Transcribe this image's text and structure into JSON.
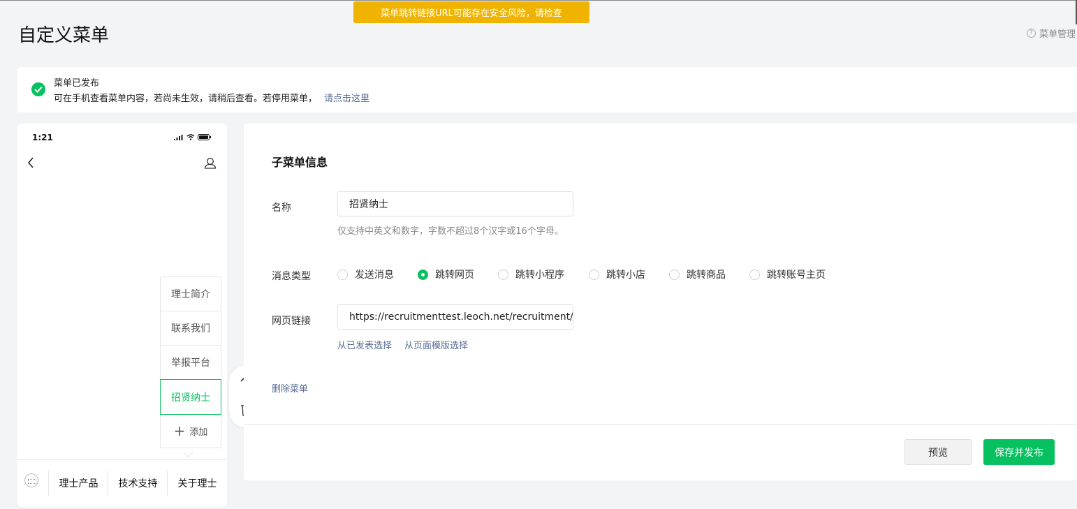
{
  "warning_toast": "菜单跳转链接URL可能存在安全风险，请检查",
  "page_title": "自定义菜单",
  "help_link": "菜单管理",
  "notice": {
    "title": "菜单已发布",
    "desc": "可在手机查看菜单内容，若尚未生效，请稍后查看。若停用菜单，",
    "link": "请点击这里"
  },
  "phone": {
    "time": "1:21",
    "submenu": [
      "理士简介",
      "联系我们",
      "举报平台",
      "招贤纳士"
    ],
    "selected_submenu": "招贤纳士",
    "add_label": "添加",
    "menu_bar": [
      "理士产品",
      "技术支持",
      "关于理士"
    ]
  },
  "editor": {
    "title": "子菜单信息",
    "name_label": "名称",
    "name_value": "招贤纳士",
    "name_hint": "仅支持中英文和数字，字数不超过8个汉字或16个字母。",
    "type_label": "消息类型",
    "types": [
      "发送消息",
      "跳转网页",
      "跳转小程序",
      "跳转小店",
      "跳转商品",
      "跳转账号主页"
    ],
    "selected_type": "跳转网页",
    "url_label": "网页链接",
    "url_value": "https://recruitmenttest.leoch.net/recruitment/",
    "url_links": [
      "从已发表选择",
      "从页面模版选择"
    ],
    "delete_label": "删除菜单",
    "preview_button": "预览",
    "publish_button": "保存并发布"
  },
  "colors": {
    "accent_green": "#07c160",
    "warning_yellow": "#f0b400",
    "link_blue": "#576b95"
  }
}
